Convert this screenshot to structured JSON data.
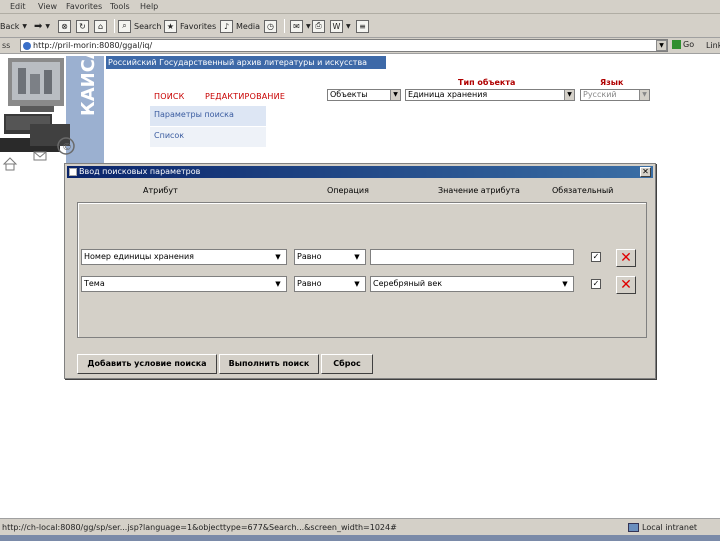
{
  "menu": [
    "Edit",
    "View",
    "Favorites",
    "Tools",
    "Help"
  ],
  "toolbar": {
    "back": "Back",
    "search": "Search",
    "favorites": "Favorites",
    "media": "Media"
  },
  "address": {
    "label": "ss",
    "url": "http://pril-morin:8080/ggal/iq/",
    "go": "Go",
    "links": "Links"
  },
  "header": {
    "logo_text": "КАИСА",
    "banner": "Российский Государственный архив литературы и искусства",
    "nav_search": "ПОИСК",
    "nav_edit": "РЕДАКТИРОВАНИЕ",
    "type_label": "Тип объекта",
    "lang_label": "Язык",
    "select_objects": "Объекты",
    "select_unit": "Единица хранения",
    "select_lang": "Русский",
    "submenu_params": "Параметры поиска",
    "submenu_list": "Список"
  },
  "dialog": {
    "title": "Ввод поисковых параметров",
    "close": "✕",
    "col_attribute": "Атрибут",
    "col_operation": "Операция",
    "col_value": "Значение атрибута",
    "col_required": "Обязательный",
    "rows": [
      {
        "attribute": "Номер единицы хранения",
        "operation": "Равно",
        "value": ""
      },
      {
        "attribute": "Тема",
        "operation": "Равно",
        "value": "Серебряный век"
      }
    ],
    "btn_add": "Добавить условие поиска",
    "btn_run": "Выполнить поиск",
    "btn_reset": "Сброс"
  },
  "status": {
    "text": "http://ch-local:8080/gg/sp/ser...jsp?language=1&objecttype=677&Search...&screen_width=1024#",
    "zone": "Local intranet"
  },
  "colors": {
    "banner": "#3d69a8",
    "nav_red": "#c80000",
    "title_bar": "#0a246a",
    "delete_red": "#e00000"
  }
}
